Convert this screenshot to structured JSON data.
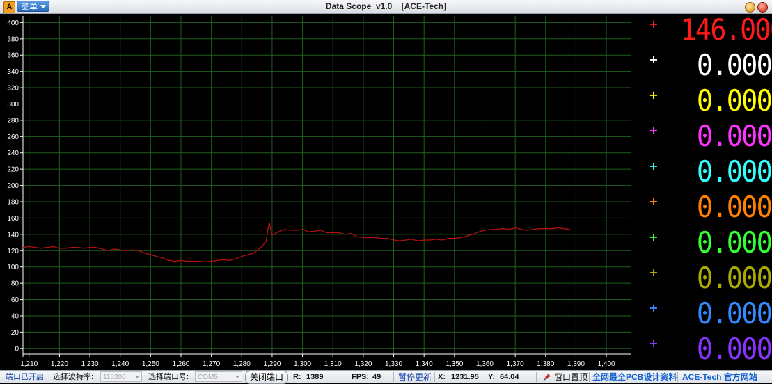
{
  "window": {
    "app_icon_label": "A",
    "menu_label": "菜单",
    "title": "Data Scope  v1.0    [ACE-Tech]"
  },
  "chart_data": {
    "type": "line",
    "x_ticks": [
      1210,
      1220,
      1230,
      1240,
      1250,
      1260,
      1270,
      1280,
      1290,
      1300,
      1310,
      1320,
      1330,
      1340,
      1350,
      1360,
      1370,
      1380,
      1390,
      1400
    ],
    "y_ticks": [
      0,
      20,
      40,
      60,
      80,
      100,
      120,
      140,
      160,
      180,
      200,
      220,
      240,
      260,
      280,
      300,
      320,
      340,
      360,
      380,
      400
    ],
    "xlim": [
      1208,
      1408
    ],
    "ylim": [
      -7,
      408
    ],
    "grid": true,
    "grid_color": "#1f5f1f",
    "axis_color": "#ffffff",
    "series": [
      {
        "color": "#b31010",
        "points": [
          [
            1208,
            124
          ],
          [
            1210,
            125
          ],
          [
            1212,
            124
          ],
          [
            1214,
            123
          ],
          [
            1216,
            124
          ],
          [
            1218,
            125
          ],
          [
            1220,
            123
          ],
          [
            1222,
            123
          ],
          [
            1224,
            124
          ],
          [
            1226,
            124
          ],
          [
            1228,
            123
          ],
          [
            1230,
            124
          ],
          [
            1232,
            124
          ],
          [
            1234,
            122
          ],
          [
            1236,
            120
          ],
          [
            1238,
            122
          ],
          [
            1240,
            121
          ],
          [
            1242,
            120
          ],
          [
            1244,
            121
          ],
          [
            1246,
            120
          ],
          [
            1248,
            117
          ],
          [
            1250,
            115
          ],
          [
            1252,
            113
          ],
          [
            1254,
            111
          ],
          [
            1256,
            108
          ],
          [
            1258,
            107
          ],
          [
            1260,
            108
          ],
          [
            1262,
            107
          ],
          [
            1264,
            107
          ],
          [
            1266,
            107
          ],
          [
            1268,
            106
          ],
          [
            1270,
            107
          ],
          [
            1272,
            108
          ],
          [
            1274,
            109
          ],
          [
            1276,
            108
          ],
          [
            1278,
            110
          ],
          [
            1280,
            113
          ],
          [
            1282,
            115
          ],
          [
            1284,
            117
          ],
          [
            1286,
            123
          ],
          [
            1288,
            131
          ],
          [
            1289,
            155
          ],
          [
            1290,
            139
          ],
          [
            1292,
            143
          ],
          [
            1294,
            146
          ],
          [
            1296,
            145
          ],
          [
            1298,
            145
          ],
          [
            1300,
            146
          ],
          [
            1302,
            143
          ],
          [
            1304,
            144
          ],
          [
            1306,
            145
          ],
          [
            1308,
            142
          ],
          [
            1310,
            142
          ],
          [
            1312,
            142
          ],
          [
            1314,
            140
          ],
          [
            1316,
            141
          ],
          [
            1318,
            137
          ],
          [
            1320,
            136
          ],
          [
            1322,
            136
          ],
          [
            1324,
            136
          ],
          [
            1326,
            135
          ],
          [
            1328,
            135
          ],
          [
            1330,
            133
          ],
          [
            1332,
            132
          ],
          [
            1334,
            133
          ],
          [
            1336,
            134
          ],
          [
            1338,
            132
          ],
          [
            1340,
            133
          ],
          [
            1342,
            133
          ],
          [
            1344,
            134
          ],
          [
            1346,
            133
          ],
          [
            1348,
            135
          ],
          [
            1350,
            135
          ],
          [
            1352,
            136
          ],
          [
            1354,
            138
          ],
          [
            1356,
            140
          ],
          [
            1358,
            143
          ],
          [
            1360,
            145
          ],
          [
            1362,
            146
          ],
          [
            1364,
            146
          ],
          [
            1366,
            147
          ],
          [
            1368,
            146
          ],
          [
            1370,
            148
          ],
          [
            1372,
            146
          ],
          [
            1374,
            145
          ],
          [
            1376,
            146
          ],
          [
            1378,
            147
          ],
          [
            1380,
            147
          ],
          [
            1382,
            147
          ],
          [
            1384,
            148
          ],
          [
            1386,
            147
          ],
          [
            1388,
            146
          ]
        ]
      }
    ]
  },
  "meters": [
    {
      "value": "146.000",
      "color": "#ff1a1a"
    },
    {
      "value": "0.000",
      "color": "#ffffff"
    },
    {
      "value": "0.000",
      "color": "#ffff00"
    },
    {
      "value": "0.000",
      "color": "#ff33ff"
    },
    {
      "value": "0.000",
      "color": "#33ffff"
    },
    {
      "value": "0.000",
      "color": "#ff8000"
    },
    {
      "value": "0.000",
      "color": "#33ff33"
    },
    {
      "value": "0.000",
      "color": "#aaaa00"
    },
    {
      "value": "0.000",
      "color": "#3388ff"
    },
    {
      "value": "0.000",
      "color": "#8833ff"
    }
  ],
  "status": {
    "port_status": "端口已开启",
    "baud_label": "选择波特率:",
    "baud_value": "115200",
    "port_label": "选择端口号:",
    "port_value": "COM5",
    "close_port": "关闭端口",
    "r_label": "R:",
    "r_value": "1389",
    "fps_label": "FPS:",
    "fps_value": "49",
    "pause_update": "暂停更新",
    "x_label": "X:",
    "x_value": "1231.95",
    "y_label": "Y:",
    "y_value": "64.04",
    "pin_top": "窗口置顶",
    "pcb_link": "全网最全PCB设计资料",
    "ace_link": "ACE-Tech 官方网站"
  }
}
